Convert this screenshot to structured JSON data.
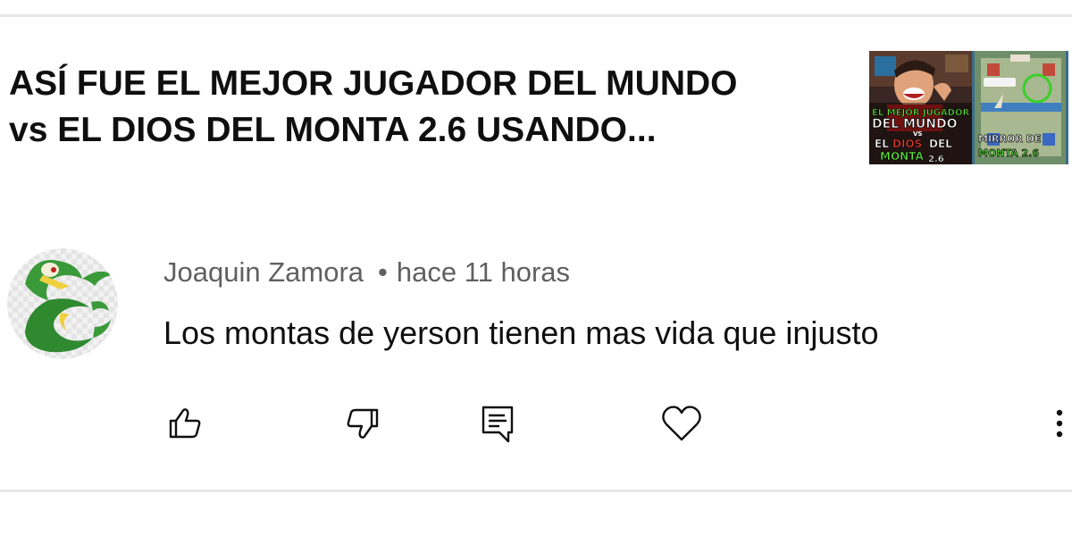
{
  "video": {
    "title_line1": "ASÍ FUE EL MEJOR JUGADOR DEL MUNDO",
    "title_line2": "vs EL DIOS DEL MONTA 2.6 USANDO...",
    "thumbnail": {
      "text_el_mejor_jugador": "EL MEJOR JUGADOR",
      "text_del_mundo": "DEL MUNDO",
      "text_vs": "VS",
      "text_el": "EL",
      "text_dios": "DIOS",
      "text_del": "DEL",
      "text_monta": "MONTA",
      "text_version": "2.6",
      "text_mirror_de": "MIRROR DE",
      "text_monta_version": "MONTA 2.6",
      "accent_green": "#58e03a",
      "accent_red": "#e03a2a"
    }
  },
  "comment": {
    "author": "Joaquin Zamora",
    "separator": "•",
    "timestamp": "hace 11 horas",
    "text": "Los montas de yerson tienen mas vida que injusto"
  },
  "actions": {
    "like_icon": "thumb-up-icon",
    "dislike_icon": "thumb-down-icon",
    "reply_icon": "reply-comment-icon",
    "heart_icon": "heart-icon",
    "more_icon": "more-vertical-icon"
  },
  "colors": {
    "primary_text": "#0f0f0f",
    "secondary_text": "#606060",
    "divider": "#e6e6e6",
    "icon": "#0f0f0f"
  }
}
